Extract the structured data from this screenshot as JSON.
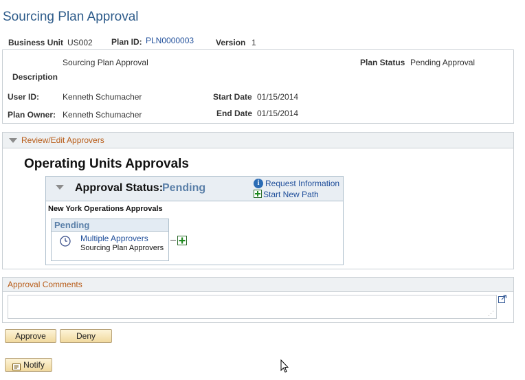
{
  "page": {
    "title": "Sourcing Plan Approval"
  },
  "header": {
    "business_unit_label": "Business Unit",
    "business_unit": "US002",
    "plan_id_label": "Plan ID:",
    "plan_id": "PLN0000003",
    "version_label": "Version",
    "version": "1"
  },
  "details": {
    "description_value": "Sourcing Plan Approval",
    "description_label": "Description",
    "plan_status_label": "Plan Status",
    "plan_status": "Pending Approval",
    "user_id_label": "User ID:",
    "user_id": "Kenneth Schumacher",
    "start_date_label": "Start Date",
    "start_date": "01/15/2014",
    "plan_owner_label": "Plan Owner:",
    "plan_owner": "Kenneth Schumacher",
    "end_date_label": "End Date",
    "end_date": "01/15/2014"
  },
  "review": {
    "section_title": "Review/Edit Approvers",
    "ops_title": "Operating Units Approvals",
    "approval_status_label": "Approval Status:",
    "approval_status": "Pending",
    "request_info": "Request Information",
    "start_new_path": "Start New Path",
    "path_name": "New York Operations Approvals",
    "stage_status": "Pending",
    "approver_link": "Multiple Approvers",
    "approver_role": "Sourcing Plan Approvers"
  },
  "comments": {
    "section_title": "Approval Comments",
    "value": ""
  },
  "buttons": {
    "approve": "Approve",
    "deny": "Deny",
    "notify": "Notify"
  },
  "colors": {
    "title_blue": "#2d5b8a",
    "section_orange": "#b85c18",
    "link_blue": "#1f4e9a",
    "button_gold": "#f1d99e"
  }
}
